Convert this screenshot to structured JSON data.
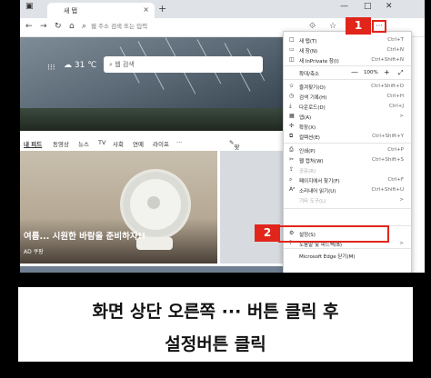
{
  "browser": {
    "tab_title": "새 탭",
    "new_tab": "+",
    "window_controls": [
      "—",
      "□",
      "✕"
    ],
    "address_placeholder": "웹 주소 검색 또는 입력"
  },
  "newtab_page": {
    "weather": "31 ℃",
    "search_placeholder": "웹 검색",
    "news_tabs": [
      "내 피드",
      "동영상",
      "뉴스",
      "TV",
      "사회",
      "연예",
      "라이프",
      "···"
    ],
    "personalize": "맞춤뉴스 설정",
    "card_headline": "여름... 시원한 바람을 준비하자!!",
    "ad_tag": "AD 쿠팡"
  },
  "menu": {
    "items": [
      {
        "label": "새 탭(T)",
        "shortcut": "Ctrl+T",
        "icon": "new-tab-icon"
      },
      {
        "label": "새 창(N)",
        "shortcut": "Ctrl+N",
        "icon": "new-window-icon"
      },
      {
        "label": "새 InPrivate 창(I)",
        "shortcut": "Ctrl+Shift+N",
        "icon": "inprivate-icon"
      },
      {
        "label": "확대/축소",
        "zoom": "100%",
        "icon": "zoom-icon"
      },
      {
        "label": "즐겨찾기(O)",
        "shortcut": "Ctrl+Shift+O",
        "icon": "star-icon"
      },
      {
        "label": "검색 기록(H)",
        "shortcut": "Ctrl+H",
        "icon": "history-icon"
      },
      {
        "label": "다운로드(D)",
        "shortcut": "Ctrl+J",
        "icon": "download-icon"
      },
      {
        "label": "앱(A)",
        "shortcut": ">",
        "icon": "apps-icon"
      },
      {
        "label": "확장(X)",
        "shortcut": "",
        "icon": "extensions-icon"
      },
      {
        "label": "컬렉션(E)",
        "shortcut": "Ctrl+Shift+Y",
        "icon": "collections-icon"
      },
      {
        "label": "인쇄(P)",
        "shortcut": "Ctrl+P",
        "icon": "print-icon"
      },
      {
        "label": "웹 캡처(W)",
        "shortcut": "Ctrl+Shift+S",
        "icon": "capture-icon"
      },
      {
        "label": "공유(R)",
        "shortcut": "",
        "icon": "share-icon",
        "disabled": true
      },
      {
        "label": "페이지에서 찾기(F)",
        "shortcut": "Ctrl+F",
        "icon": "find-icon"
      },
      {
        "label": "소리내어 읽기(U)",
        "shortcut": "Ctrl+Shift+U",
        "icon": "read-aloud-icon"
      },
      {
        "label": "기타 도구(L)",
        "shortcut": ">",
        "icon": "",
        "disabled": true
      },
      {
        "label": "설정(S)",
        "shortcut": "",
        "icon": "settings-icon"
      },
      {
        "label": "도움말 및 피드백(B)",
        "shortcut": ">",
        "icon": "help-icon"
      },
      {
        "label": "Microsoft Edge 닫기(M)",
        "shortcut": "",
        "icon": ""
      }
    ]
  },
  "badges": {
    "one": "1",
    "two": "2",
    "accent": "#e1251b"
  },
  "caption": {
    "line1": "화면 상단 오른쪽 ··· 버튼 클릭 후",
    "line2": "설정버튼 클릭"
  }
}
